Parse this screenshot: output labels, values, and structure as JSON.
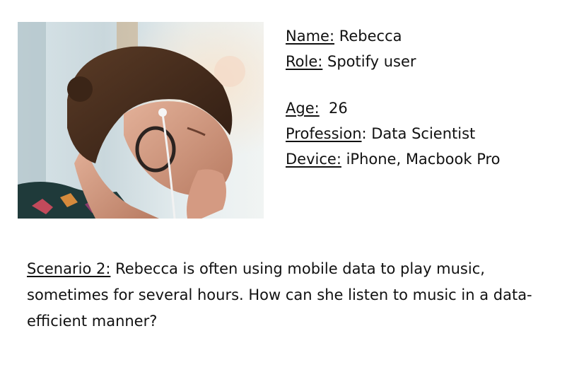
{
  "persona": {
    "photo": {
      "icon": "woman-with-earphones-photo"
    },
    "fields": [
      {
        "label": "Name:",
        "value": " Rebecca"
      },
      {
        "label": "Role:",
        "value": " Spotify user"
      },
      {
        "label": "Age:",
        "value": "  26"
      },
      {
        "label": "Profession",
        "value": ": Data Scientist"
      },
      {
        "label": "Device:",
        "value": " iPhone, Macbook Pro"
      }
    ]
  },
  "scenario": {
    "label": "Scenario 2:",
    "text": " Rebecca is often using mobile data to play music, sometimes for several hours. How can she listen to music in a data-efficient manner?"
  }
}
